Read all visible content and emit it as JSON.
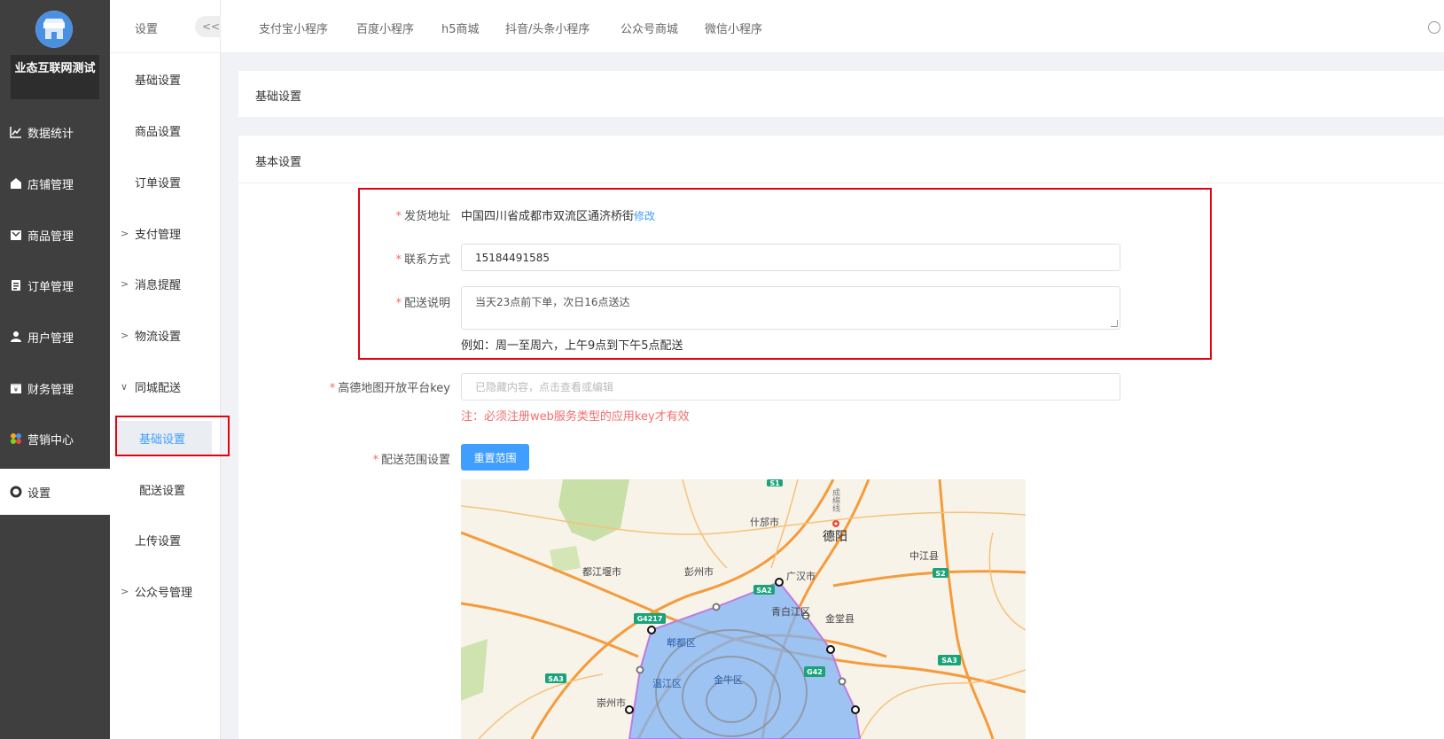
{
  "brand": {
    "name": "业态互联网测试"
  },
  "main_nav": [
    {
      "label": "数据统计",
      "icon": "chart-line-icon"
    },
    {
      "label": "店铺管理",
      "icon": "store-icon"
    },
    {
      "label": "商品管理",
      "icon": "goods-icon"
    },
    {
      "label": "订单管理",
      "icon": "order-icon"
    },
    {
      "label": "用户管理",
      "icon": "user-icon"
    },
    {
      "label": "财务管理",
      "icon": "finance-icon"
    },
    {
      "label": "营销中心",
      "icon": "marketing-icon"
    },
    {
      "label": "设置",
      "icon": "gear-icon",
      "active": true
    }
  ],
  "sub_nav": {
    "title": "设置",
    "collapse_label": "<<",
    "items": [
      {
        "label": "基础设置"
      },
      {
        "label": "商品设置"
      },
      {
        "label": "订单设置"
      },
      {
        "label": "支付管理"
      },
      {
        "label": "消息提醒"
      },
      {
        "label": "物流设置"
      },
      {
        "label": "同城配送"
      },
      {
        "label": "基础设置"
      },
      {
        "label": "配送设置"
      },
      {
        "label": "上传设置"
      },
      {
        "label": "公众号管理"
      }
    ]
  },
  "top_tabs": [
    "支付宝小程序",
    "百度小程序",
    "h5商城",
    "抖音/头条小程序",
    "公众号商城",
    "微信小程序"
  ],
  "breadcrumb_card": "基础设置",
  "section_title": "基本设置",
  "form": {
    "ship_address": {
      "label": "发货地址",
      "value": "中国四川省成都市双流区通济桥街",
      "edit": "修改"
    },
    "contact": {
      "label": "联系方式",
      "value": "15184491585"
    },
    "delivery_note": {
      "label": "配送说明",
      "value": "当天23点前下单，次日16点送达",
      "hint": "例如：周一至周六，上午9点到下午5点配送"
    },
    "amap_key": {
      "label": "高德地图开放平台key",
      "placeholder": "已隐藏内容，点击查看或编辑",
      "warning": "注：必须注册web服务类型的应用key才有效"
    },
    "range": {
      "label": "配送范围设置",
      "button": "重置范围"
    }
  },
  "map": {
    "labels": {
      "deyang": "德阳",
      "shifang": "什邡市",
      "zhongjiang": "中江县",
      "dujiangyan": "都江堰市",
      "pengzhou": "彭州市",
      "guanghan": "广汉市",
      "qingbaijiang": "青白江区",
      "jintang": "金堂县",
      "pidu": "郫都区",
      "wenjiang": "温江区",
      "jinniu": "金牛区",
      "chongzhou": "崇州市"
    },
    "roads": {
      "s1": "S1",
      "sa2": "SA2",
      "s2": "S2",
      "g4217": "G4217",
      "g42": "G42",
      "sa3_left": "SA3",
      "sa3_right": "SA3",
      "vertical": "成绵线"
    }
  }
}
